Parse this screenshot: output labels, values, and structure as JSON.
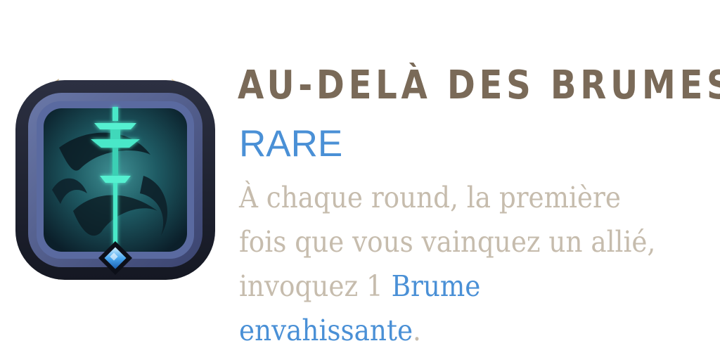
{
  "augment": {
    "title": "AU-DELÀ DES BRUMES",
    "rarity": "RARE",
    "description": {
      "line1": "À chaque round, la première",
      "line2": "fois que vous vainquez un allié,",
      "line3_text": "invoquez 1 ",
      "keyword_part1": "Brume",
      "keyword_part2": "envahissante",
      "end_punct": "."
    }
  },
  "colors": {
    "title": "#7a6a58",
    "rarity": "#4a90d6",
    "description": "#c6bcad",
    "keyword": "#4a90d6"
  },
  "icon": {
    "name": "mist-sword-augment-icon",
    "gem": "blue-diamond-gem"
  }
}
